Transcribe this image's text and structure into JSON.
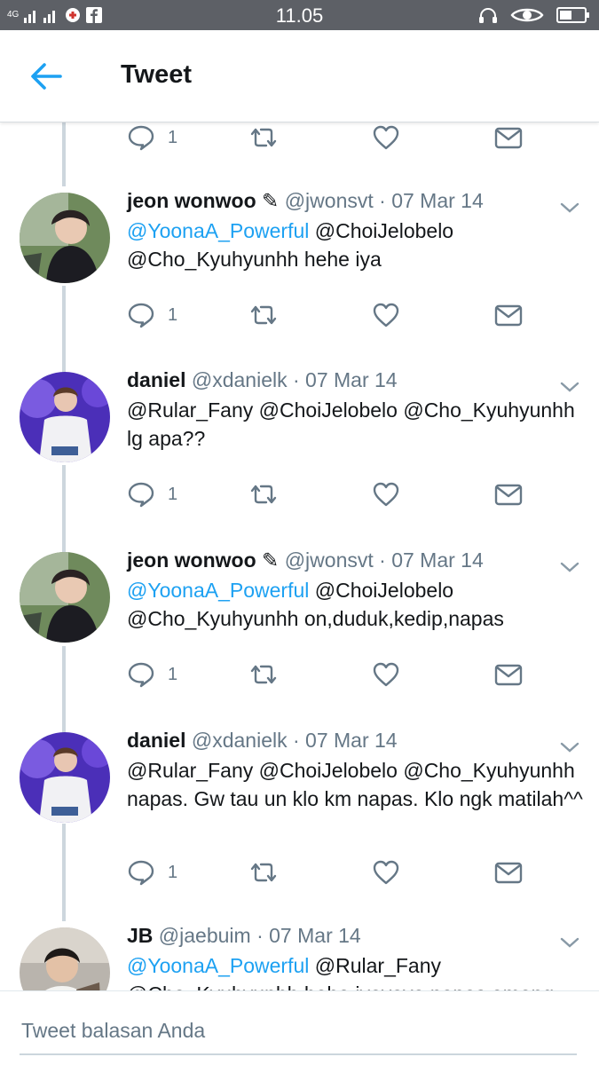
{
  "status_bar": {
    "network": "4G",
    "time": "11.05"
  },
  "header": {
    "title": "Tweet",
    "back_icon": "arrow-left-icon"
  },
  "colors": {
    "accent": "#1da1f2",
    "secondary_text": "#657786",
    "thread_line": "#cdd6dd",
    "status_bar": "#5d6066"
  },
  "top_actions": {
    "reply_count": "1"
  },
  "tweets": [
    {
      "name": "jeon wonwoo ✎",
      "handle": "@jwonsvt",
      "date": "· 07 Mar 14",
      "mention": "@YoonaA_Powerful",
      "text": " @ChoiJelobelo @Cho_Kyuhyunhh hehe iya",
      "reply_count": "1"
    },
    {
      "name": "daniel",
      "handle": "@xdanielk",
      "date": "· 07 Mar 14",
      "mention": "",
      "text": "@Rular_Fany @ChoiJelobelo @Cho_Kyuhyunhh lg apa??",
      "reply_count": "1"
    },
    {
      "name": "jeon wonwoo ✎",
      "handle": "@jwonsvt",
      "date": "· 07 Mar 14",
      "mention": "@YoonaA_Powerful",
      "text": " @ChoiJelobelo @Cho_Kyuhyunhh on,duduk,kedip,napas",
      "reply_count": "1"
    },
    {
      "name": "daniel",
      "handle": "@xdanielk",
      "date": "· 07 Mar 14",
      "mention": "",
      "text": "@Rular_Fany @ChoiJelobelo @Cho_Kyuhyunhh napas. Gw tau un klo km napas. Klo ngk matilah^^",
      "reply_count": "1"
    },
    {
      "name": "JB",
      "handle": "@jaebuim",
      "date": "· 07 Mar 14",
      "mention": "@YoonaA_Powerful",
      "text": " @Rular_Fany @Cho_Kyuhyunhh hehe iyayaya napas emang",
      "reply_count": ""
    }
  ],
  "composer": {
    "placeholder": "Tweet balasan Anda"
  }
}
